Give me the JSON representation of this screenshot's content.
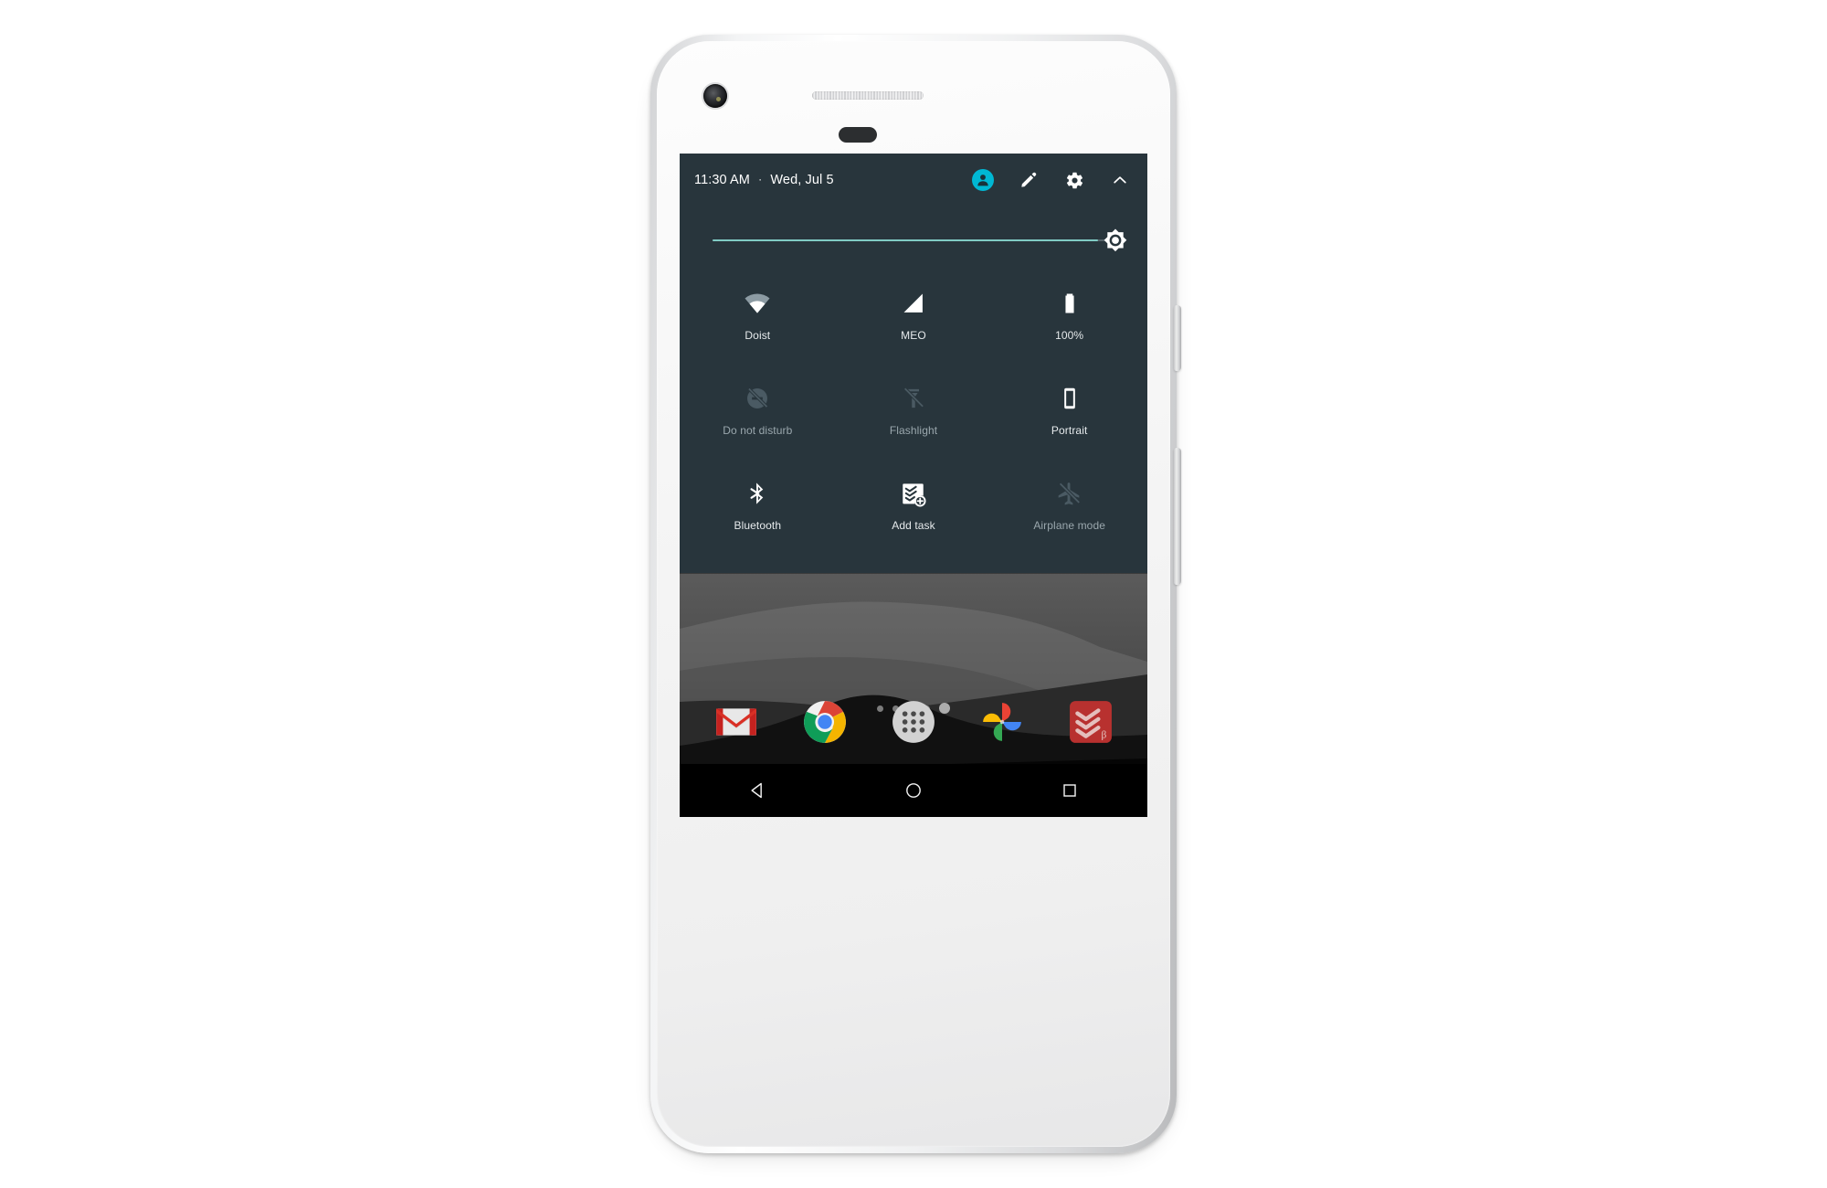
{
  "device": {
    "name": "google-pixel-white",
    "camera": "front-camera",
    "speaker": "earpiece-speaker",
    "sensor": "proximity-sensor",
    "buttons": [
      "power-button",
      "volume-rocker"
    ]
  },
  "colors": {
    "panel_bg": "#28353c",
    "accent_teal": "#80cbc4",
    "avatar_cyan": "#00b8d4",
    "icon_on": "#ffffff",
    "icon_off": "#4a5a63",
    "label_on": "#e6eaec",
    "label_off": "#9aa7ad",
    "navbar_bg": "#000000",
    "todoist_red": "#b8312f"
  },
  "quick_settings": {
    "time": "11:30 AM",
    "separator": "·",
    "date": "Wed, Jul 5",
    "header_actions": [
      {
        "name": "user-avatar",
        "icon": "person-icon",
        "label": "User"
      },
      {
        "name": "edit-button",
        "icon": "pencil-icon",
        "label": "Edit"
      },
      {
        "name": "settings-button",
        "icon": "gear-icon",
        "label": "Settings"
      },
      {
        "name": "collapse-button",
        "icon": "chevron-up-icon",
        "label": "Collapse"
      }
    ],
    "brightness": {
      "name": "brightness-slider",
      "icon": "brightness-sun-icon",
      "value": 96,
      "min": 0,
      "max": 100
    },
    "tiles": [
      {
        "label": "Doist",
        "icon": "wifi-icon",
        "state": "on"
      },
      {
        "label": "MEO",
        "icon": "signal-icon",
        "state": "on"
      },
      {
        "label": "100%",
        "icon": "battery-icon",
        "state": "on"
      },
      {
        "label": "Do not disturb",
        "icon": "do-not-disturb-icon",
        "state": "off"
      },
      {
        "label": "Flashlight",
        "icon": "flashlight-icon",
        "state": "off"
      },
      {
        "label": "Portrait",
        "icon": "rotation-icon",
        "state": "on"
      },
      {
        "label": "Bluetooth",
        "icon": "bluetooth-icon",
        "state": "on"
      },
      {
        "label": "Add task",
        "icon": "todoist-add-task-icon",
        "state": "on"
      },
      {
        "label": "Airplane mode",
        "icon": "airplane-off-icon",
        "state": "off"
      }
    ]
  },
  "homescreen": {
    "page_dots": {
      "count": 5,
      "active_index": 4
    },
    "dock": [
      {
        "label": "Gmail",
        "icon": "gmail-icon"
      },
      {
        "label": "Chrome",
        "icon": "chrome-icon"
      },
      {
        "label": "Apps",
        "icon": "app-drawer-icon"
      },
      {
        "label": "Photos",
        "icon": "google-photos-icon"
      },
      {
        "label": "Todoist",
        "icon": "todoist-icon",
        "badge": "β"
      }
    ]
  },
  "navbar": [
    {
      "label": "Back",
      "icon": "back-triangle-icon"
    },
    {
      "label": "Home",
      "icon": "home-circle-icon"
    },
    {
      "label": "Recents",
      "icon": "recents-square-icon"
    }
  ]
}
